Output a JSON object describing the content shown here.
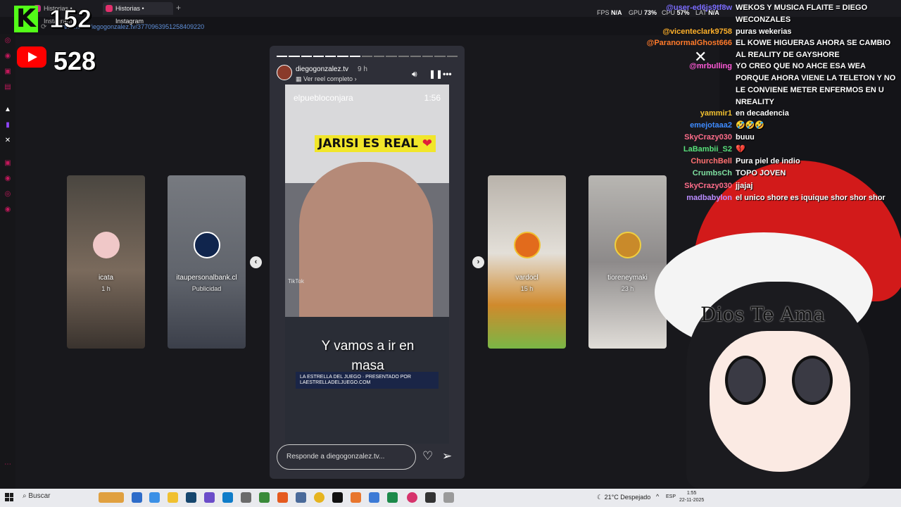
{
  "browser": {
    "tabs": [
      {
        "label": "Historias • Instagram",
        "active": false
      },
      {
        "label": "Historias • Instagram",
        "active": true
      }
    ],
    "url": ".com/stories/diegogonzalez.tv/3770963951258409220"
  },
  "stats": {
    "fps_label": "FPS",
    "fps": "N/A",
    "gpu_label": "GPU",
    "gpu": "73%",
    "cpu_label": "CPU",
    "cpu": "57%",
    "lat_label": "LAT",
    "lat": "N/A"
  },
  "overlay": {
    "kick_logo": "K",
    "kick_viewers": "152",
    "youtube_viewers": "528"
  },
  "stories": {
    "side_cards": [
      {
        "name": "icata",
        "time": "1 h"
      },
      {
        "name": "itaupersonalbank.cl",
        "time": "Publicidad"
      },
      {
        "name": "vardocl",
        "time": "15 h"
      },
      {
        "name": "tioreneymaki",
        "time": "23 h"
      }
    ],
    "current": {
      "username": "diegogonzalez.tv",
      "time": "9 h",
      "reel_link": "Ver reel completo",
      "video_source": "elpuebloconjara",
      "duration": "1:56",
      "banner": "JARISI ES REAL",
      "caption": "Y vamos a ir en masa",
      "watermark": "TikTok",
      "ad_text": "LA ESTRELLA DEL JUEGO · PRESENTADO POR LAESTRELLADELJUEGO.COM",
      "reply_placeholder": "Responde a diegogonzalez.tv..."
    },
    "progress_total": 15,
    "progress_done": 7
  },
  "chat": [
    {
      "user": "@user-ed6js9tf8w",
      "text": "WEKOS Y MUSICA FLAITE = DIEGO WECONZALES",
      "color": "#7b6cff"
    },
    {
      "user": "@vicenteclark9758",
      "text": "puras wekerias",
      "color": "#ffb12a"
    },
    {
      "user": "@ParanormalGhost666",
      "text": "EL KOWE HIGUERAS AHORA SE CAMBIO AL REALITY DE GAYSHORE",
      "color": "#ff7a2a"
    },
    {
      "user": "@mrbulling",
      "text": "YO CREO QUE NO AHCE ESA WEA PORQUE AHORA VIENE LA TELETON Y NO LE CONVIENE METER ENFERMOS EN U NREALITY",
      "color": "#ff5ad8"
    },
    {
      "user": "yammir1",
      "text": "en decadencia",
      "color": "#f2c130"
    },
    {
      "user": "emejotaaa2",
      "text": "🤣🤣🤣",
      "color": "#3e8bff"
    },
    {
      "user": "SkyCrazy030",
      "text": "buuu",
      "color": "#ff6d8a"
    },
    {
      "user": "LaBambii_S2",
      "text": "💔",
      "color": "#57e07a"
    },
    {
      "user": "ChurchBell",
      "text": "Pura piel de indio",
      "color": "#ff7070"
    },
    {
      "user": "CrumbsCh",
      "text": "TOPO JOVEN",
      "color": "#7ee0a0"
    },
    {
      "user": "SkyCrazy030",
      "text": "jjajaj",
      "color": "#ff6d8a"
    },
    {
      "user": "madbabylon",
      "text": "el unico shore es iquique shor shor shor",
      "color": "#b98cff"
    }
  ],
  "vtuber": {
    "hat_text": "Dios Te Ama"
  },
  "taskbar": {
    "search": "Buscar",
    "weather": "21°C  Despejado",
    "lang": "ESP",
    "time": "1:55",
    "date": "22-11-2025"
  }
}
